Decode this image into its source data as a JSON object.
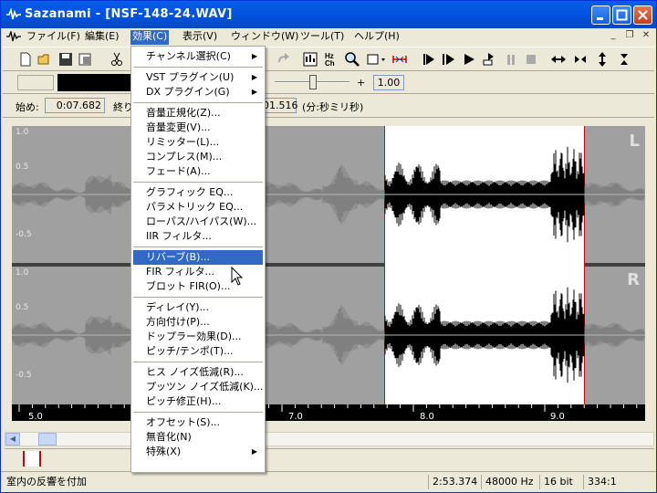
{
  "window": {
    "title": "Sazanami - [NSF-148-24.WAV]"
  },
  "menubar": [
    {
      "label": "ファイル(F)",
      "name": "menu-file"
    },
    {
      "label": "編集(E)",
      "name": "menu-edit"
    },
    {
      "label": "効果(C)",
      "name": "menu-effect",
      "active": true
    },
    {
      "label": "表示(V)",
      "name": "menu-view"
    },
    {
      "label": "ウィンドウ(W)",
      "name": "menu-window"
    },
    {
      "label": "ツール(T)",
      "name": "menu-tools"
    },
    {
      "label": "ヘルプ(H)",
      "name": "menu-help"
    }
  ],
  "effect_menu": [
    {
      "label": "チャンネル選択(C)",
      "submenu": true
    },
    {
      "sep": true
    },
    {
      "label": "VST プラグイン(U)",
      "submenu": true
    },
    {
      "label": "DX プラグイン(G)",
      "submenu": true
    },
    {
      "sep": true
    },
    {
      "label": "音量正規化(Z)..."
    },
    {
      "label": "音量変更(V)..."
    },
    {
      "label": "リミッター(L)..."
    },
    {
      "label": "コンプレス(M)..."
    },
    {
      "label": "フェード(A)..."
    },
    {
      "sep": true
    },
    {
      "label": "グラフィック EQ..."
    },
    {
      "label": "パラメトリック EQ..."
    },
    {
      "label": "ローパス/ハイパス(W)..."
    },
    {
      "label": "IIR フィルタ..."
    },
    {
      "sep": true
    },
    {
      "label": "リバーブ(B)...",
      "highlighted": true
    },
    {
      "label": "FIR フィルタ..."
    },
    {
      "label": "ブロット FIR(O)..."
    },
    {
      "sep": true
    },
    {
      "label": "ディレイ(Y)..."
    },
    {
      "label": "方向付け(P)..."
    },
    {
      "label": "ドップラー効果(D)..."
    },
    {
      "label": "ピッチ/テンポ(T)..."
    },
    {
      "sep": true
    },
    {
      "label": "ヒス ノイズ低減(R)..."
    },
    {
      "label": "プッツン ノイズ低減(K)..."
    },
    {
      "label": "ピッチ修正(H)..."
    },
    {
      "sep": true
    },
    {
      "label": "オフセット(S)..."
    },
    {
      "label": "無音化(N)"
    },
    {
      "label": "特殊(X)",
      "submenu": true
    }
  ],
  "toolbar2": {
    "plus_label": "+",
    "speed_value": "1.00"
  },
  "posbar": {
    "start_label": "始め:",
    "start_value": "0:07.682",
    "end_label": "終り",
    "end_value": "01.516",
    "unit_label": "(分:秒ミリ秒)"
  },
  "wave": {
    "left_label": "L",
    "right_label": "R",
    "ylabels": [
      "1.0",
      "0.5",
      "-0.5",
      "1.0",
      "0.5",
      "-0.5"
    ]
  },
  "ruler": {
    "ticks": [
      "5.0",
      "7.0",
      "8.0",
      "9.0"
    ]
  },
  "status": {
    "hint": "室内の反響を付加",
    "length": "2:53.374",
    "rate": "48000 Hz",
    "bits": "16 bit",
    "zoom": "334:1"
  },
  "colors": {
    "title_blue": "#0054E3",
    "selection_border": "#E00000",
    "menu_highlight": "#316AC5"
  }
}
